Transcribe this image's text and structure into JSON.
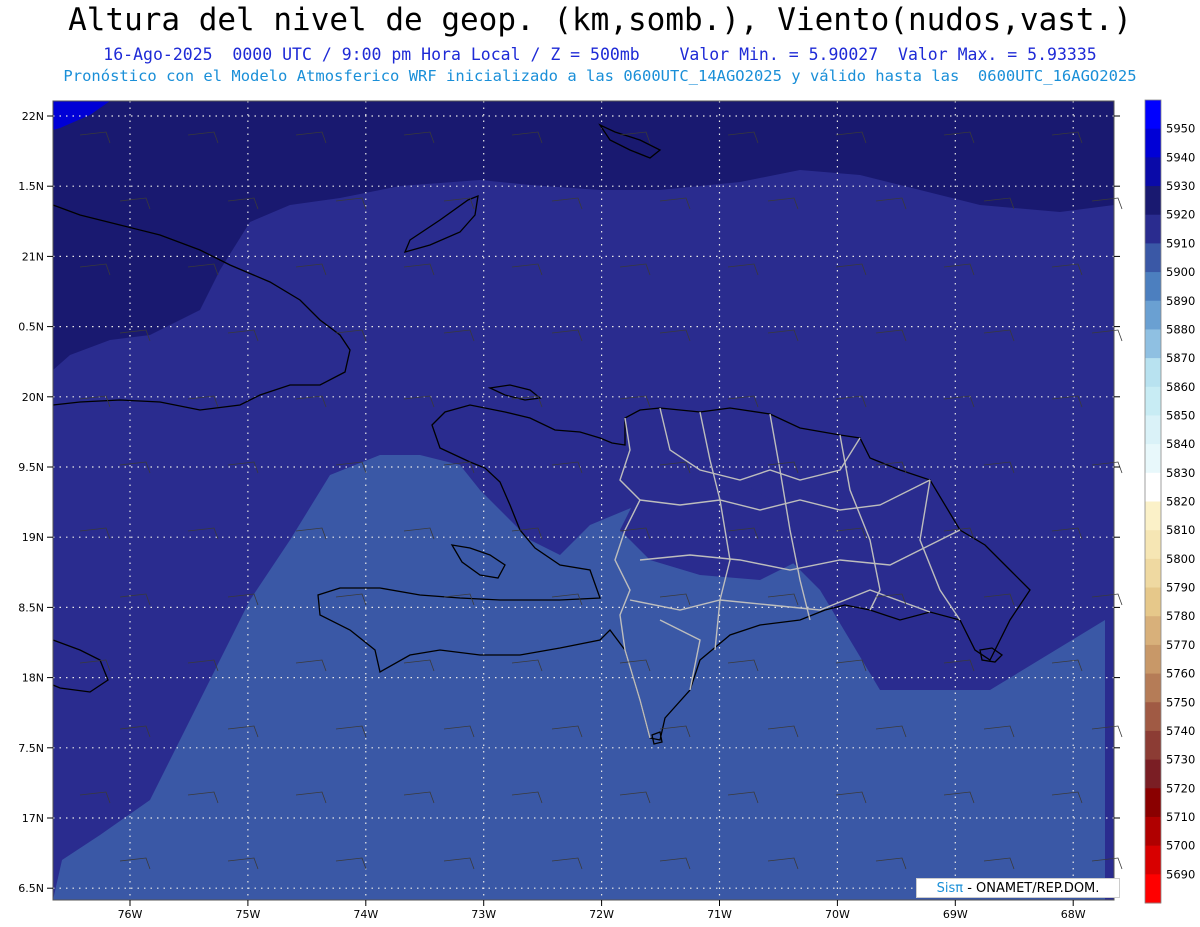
{
  "title": "Altura del nivel de geop. (km,somb.), Viento(nudos,vast.)",
  "subtitle_line1": "16-Ago-2025  0000 UTC / 9:00 pm Hora Local / Z = 500mb    Valor Min. = 5.90027  Valor Max. = 5.93335",
  "subtitle_line2": "Pronóstico con el Modelo Atmosferico WRF inicializado a las 0600UTC_14AGO2025 y válido hasta las  0600UTC_16AGO2025",
  "axes": {
    "lat_labels": [
      "22N",
      "1.5N",
      "21N",
      "0.5N",
      "20N",
      "9.5N",
      "19N",
      "8.5N",
      "18N",
      "7.5N",
      "17N",
      "6.5N"
    ],
    "lon_labels": [
      "76W",
      "75W",
      "74W",
      "73W",
      "72W",
      "71W",
      "70W",
      "69W",
      "68W"
    ]
  },
  "colorbar": {
    "levels": [
      5950,
      5940,
      5930,
      5920,
      5910,
      5900,
      5890,
      5880,
      5870,
      5860,
      5850,
      5840,
      5830,
      5820,
      5810,
      5800,
      5790,
      5780,
      5770,
      5760,
      5750,
      5740,
      5730,
      5720,
      5710,
      5700,
      5690
    ],
    "colors": [
      "#0000ff",
      "#0000d6",
      "#0a0aa8",
      "#191970",
      "#2a2c8f",
      "#3a58a6",
      "#4c7fbf",
      "#6aa0d2",
      "#8fc0e2",
      "#b8e2f0",
      "#c8ecf4",
      "#daf2f8",
      "#e8f8fb",
      "#ffffff",
      "#fbf1c8",
      "#f6e6b4",
      "#efd9a1",
      "#e6c88a",
      "#d8b07a",
      "#c89868",
      "#b57c57",
      "#a05a44",
      "#8c3c34",
      "#7a1e24",
      "#8a0000",
      "#b00000",
      "#d80000",
      "#ff0000"
    ]
  },
  "field_colors": {
    "ocean_low": "#3a58a6",
    "ocean_mid": "#2a2c8f",
    "ocean_high": "#191970",
    "peak": "#0000d6",
    "coast": "#000000",
    "borders": "#bdbdbd"
  },
  "credit": {
    "brand": "Sisπ",
    "text": " - ONAMET/REP.DOM."
  }
}
